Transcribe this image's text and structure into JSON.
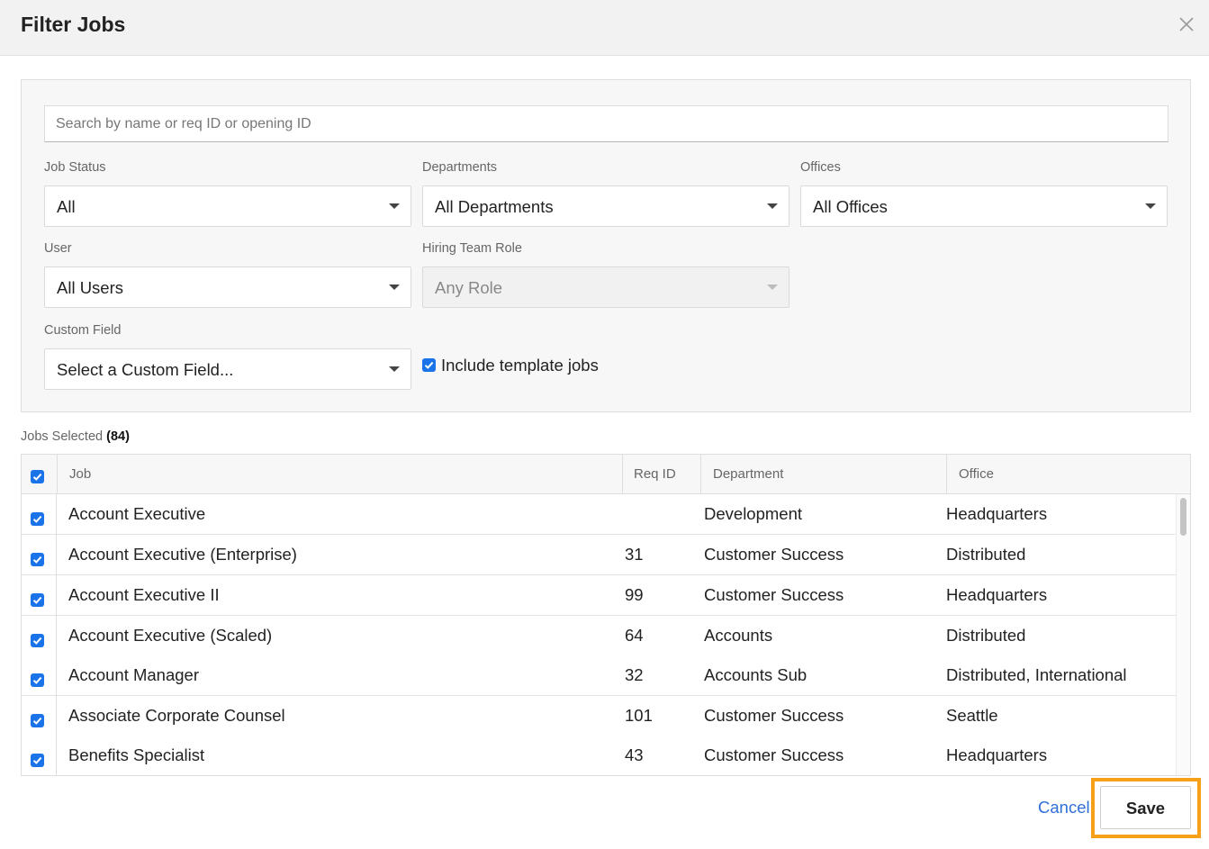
{
  "modal": {
    "title": "Filter Jobs"
  },
  "search": {
    "placeholder": "Search by name or req ID or opening ID"
  },
  "filters": {
    "job_status": {
      "label": "Job Status",
      "value": "All"
    },
    "departments": {
      "label": "Departments",
      "value": "All Departments"
    },
    "offices": {
      "label": "Offices",
      "value": "All Offices"
    },
    "user": {
      "label": "User",
      "value": "All Users"
    },
    "hiring_team_role": {
      "label": "Hiring Team Role",
      "value": "Any Role",
      "disabled": true
    },
    "custom_field": {
      "label": "Custom Field",
      "value": "Select a Custom Field..."
    },
    "include_template_jobs": {
      "label": "Include template jobs",
      "checked": true
    }
  },
  "selection": {
    "label": "Jobs Selected",
    "count": "(84)"
  },
  "table": {
    "columns": {
      "job": "Job",
      "req_id": "Req ID",
      "department": "Department",
      "office": "Office"
    },
    "rows": [
      {
        "job": "Account Executive",
        "req_id": "",
        "department": "Development",
        "office": "Headquarters",
        "checked": true
      },
      {
        "job": "Account Executive (Enterprise)",
        "req_id": "31",
        "department": "Customer Success",
        "office": "Distributed",
        "checked": true
      },
      {
        "job": "Account Executive II",
        "req_id": "99",
        "department": "Customer Success",
        "office": "Headquarters",
        "checked": true
      },
      {
        "job": "Account Executive (Scaled)",
        "req_id": "64",
        "department": "Accounts",
        "office": "Distributed",
        "checked": true
      },
      {
        "job": "Account Manager",
        "req_id": "32",
        "department": "Accounts Sub",
        "office": "Distributed, International",
        "checked": true
      },
      {
        "job": "Associate Corporate Counsel",
        "req_id": "101",
        "department": "Customer Success",
        "office": "Seattle",
        "checked": true
      },
      {
        "job": "Benefits Specialist",
        "req_id": "43",
        "department": "Customer Success",
        "office": "Headquarters",
        "checked": true
      }
    ]
  },
  "footer": {
    "cancel_label": "Cancel",
    "save_label": "Save"
  },
  "colors": {
    "accent": "#1a73e8",
    "link": "#2f6fd8",
    "highlight": "#f6a01a"
  }
}
